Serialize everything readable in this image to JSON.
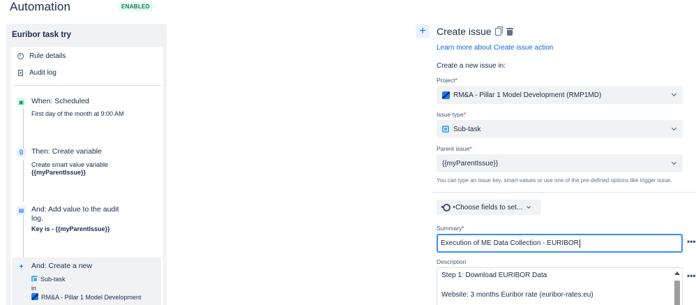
{
  "header": {
    "title": "Automation",
    "status_badge": "ENABLED"
  },
  "rule": {
    "name": "Euribor task try",
    "nav": [
      {
        "label": "Rule details",
        "icon": "info-icon"
      },
      {
        "label": "Audit log",
        "icon": "document-icon"
      }
    ],
    "steps": [
      {
        "title": "When: Scheduled",
        "lines": [
          "First day of the month at 9:00 AM"
        ],
        "icon": "calendar-icon",
        "icon_glyph": "▣"
      },
      {
        "title": "Then: Create variable",
        "lines": [
          "Create smart value variable",
          "{{myParentIssue}}"
        ],
        "icon": "braces-icon",
        "icon_glyph": "{}"
      },
      {
        "title": "And: Add value to the audit log.",
        "lines": [
          "Key is - {{myParentIssue}}"
        ],
        "icon": "audit-icon",
        "icon_glyph": "▤"
      },
      {
        "title": "And: Create a new",
        "lines": [
          "Sub-task",
          "in",
          "RM&A - Pillar 1 Model Development"
        ],
        "icon": "plus-icon",
        "icon_glyph": "+"
      }
    ]
  },
  "editor": {
    "title": "Create issue",
    "learn_link": "Learn more about Create issue action",
    "create_in_label": "Create a new issue in:",
    "project": {
      "label": "Project",
      "required_mark": "*",
      "value": "RM&A - Pillar 1 Model Development (RMP1MD)"
    },
    "issue_type": {
      "label": "Issue type",
      "required_mark": "*",
      "value": "Sub-task"
    },
    "parent_issue": {
      "label": "Parent issue",
      "required_mark": "*",
      "value": "{{myParentIssue}}",
      "helper": "You can type an issue key, smart-values or use one of the pre-defined options like trigger issue."
    },
    "choose_fields_label": "Choose fields to set...",
    "summary": {
      "label": "Summary",
      "required_mark": "*",
      "value": "Execution of ME Data Collection - EURIBOR"
    },
    "description": {
      "label": "Description",
      "lines": [
        "Step 1: Download EURIBOR Data",
        "Website: 3 months Euribor rate (euribor-rates.eu)"
      ]
    },
    "more_glyph": "•••",
    "plus_glyph": "+"
  },
  "colors": {
    "accent": "#0c66e4",
    "badge_bg": "#dcfff1",
    "badge_text": "#216e4e",
    "focus_border": "#388bff"
  }
}
